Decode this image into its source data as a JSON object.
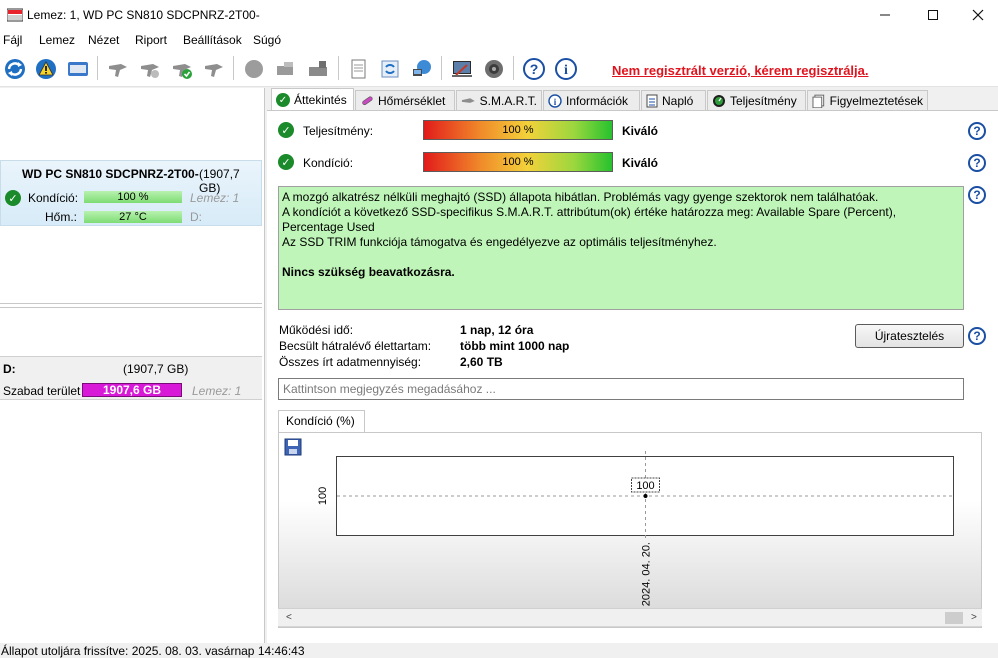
{
  "window": {
    "title": "Lemez: 1, WD PC SN810 SDCPNRZ-2T00-",
    "controls": [
      "minimize-icon",
      "maximize-icon",
      "close-icon"
    ]
  },
  "menu": {
    "items": [
      {
        "label": "Fájl"
      },
      {
        "label": "Lemez"
      },
      {
        "label": "Nézet"
      },
      {
        "label": "Riport"
      },
      {
        "label": "Beállítások"
      },
      {
        "label": "Súgó"
      }
    ]
  },
  "toolbar": {
    "icons": [
      "refresh-icon",
      "warning-icon",
      "disk-icon",
      "tool-gray-icon",
      "tool-gray-2-icon",
      "tool-check-icon",
      "tool-gray-3-icon",
      "circle-gray-icon",
      "drive-gray-icon",
      "drive-gray-2-icon",
      "document-icon",
      "sync-icon",
      "network-icon",
      "settings-icon",
      "speaker-icon",
      "help-icon",
      "info-icon"
    ],
    "register_warning": "Nem regisztrált verzió, kérem regisztrálja."
  },
  "left": {
    "disk": {
      "name": "WD PC SN810 SDCPNRZ-2T00-",
      "size": "(1907,7 GB)",
      "condition_label": "Kondíció:",
      "condition_value": "100 %",
      "disk_label": "Lemez: 1",
      "temp_label": "Hőm.:",
      "temp_value": "27 °C",
      "drive_letter": "D:"
    },
    "partition": {
      "letter": "D:",
      "size": "(1907,7 GB)",
      "free_label": "Szabad terület",
      "free_value": "1907,6 GB",
      "disk_label": "Lemez: 1"
    }
  },
  "tabs": [
    {
      "label": "Áttekintés",
      "icon": "check-icon"
    },
    {
      "label": "Hőmérséklet",
      "icon": "thermometer-icon"
    },
    {
      "label": "S.M.A.R.T.",
      "icon": "disk-icon"
    },
    {
      "label": "Információk",
      "icon": "info-icon"
    },
    {
      "label": "Napló",
      "icon": "log-icon"
    },
    {
      "label": "Teljesítmény",
      "icon": "gauge-icon"
    },
    {
      "label": "Figyelmeztetések",
      "icon": "alerts-icon"
    }
  ],
  "overview": {
    "performance_label": "Teljesítmény:",
    "performance_value": "100 %",
    "performance_rating": "Kiváló",
    "performance_level": 1.0,
    "condition_label": "Kondíció:",
    "condition_value": "100 %",
    "condition_rating": "Kiváló",
    "condition_level": 1.0,
    "info_lines": [
      "A mozgó alkatrész nélküli meghajtó (SSD) állapota hibátlan. Problémás vagy gyenge szektorok nem találhatóak.",
      "A kondíciót a következő SSD-specifikus S.M.A.R.T. attribútum(ok) értéke határozza meg:  Available Spare (Percent), Percentage Used",
      "Az SSD TRIM funkciója támogatva és engedélyezve az optimális teljesítményhez."
    ],
    "info_bold": "Nincs szükség beavatkozásra.",
    "uptime_label": "Működési idő:",
    "uptime_value": "1 nap, 12 óra",
    "lifetime_label": "Becsült hátralévő élettartam:",
    "lifetime_value": "több mint 1000 nap",
    "written_label": "Összes írt adatmennyiség:",
    "written_value": "2,60 TB",
    "retest_button": "Újratesztelés",
    "note_placeholder": "Kattintson megjegyzés megadásához ..."
  },
  "chart_tab": {
    "label": "Kondíció  (%)"
  },
  "chart_data": {
    "type": "line",
    "x": [
      "2024. 04. 20."
    ],
    "series": [
      {
        "values": [
          100
        ]
      }
    ],
    "data_labels": [
      "100"
    ],
    "y_tick_labels": [
      "100"
    ],
    "grid": true
  },
  "status": {
    "text": "Állapot utoljára frissítve: 2025. 08. 03. vasárnap 14:46:43"
  }
}
